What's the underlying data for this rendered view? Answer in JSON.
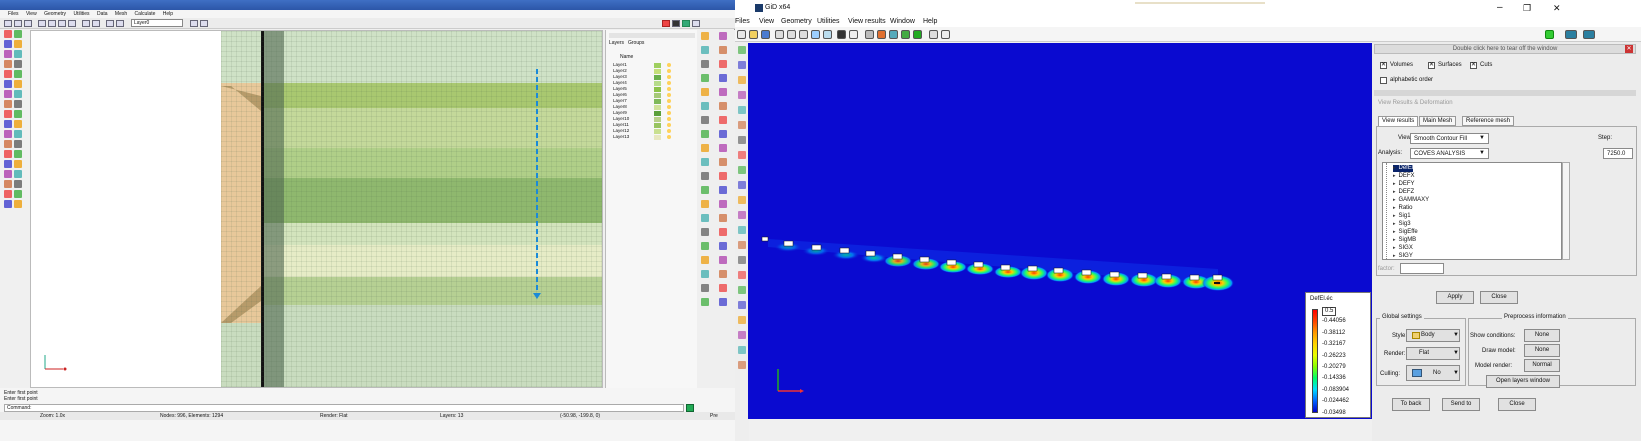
{
  "left_window": {
    "menu": [
      "Files",
      "View",
      "Geometry",
      "Utilities",
      "Data",
      "Mesh",
      "Calculate",
      "Help"
    ],
    "layer_select": "Layer0",
    "layers_tabs": [
      "Layers",
      "Groups"
    ],
    "layers_header": "Name",
    "layers": [
      "Layer1",
      "Layer2",
      "Layer3",
      "Layer4",
      "Layer5",
      "Layer6",
      "Layer7",
      "Layer8",
      "Layer9",
      "Layer10",
      "Layer11",
      "Layer12",
      "Layer13"
    ],
    "prompt_lines": [
      "Enter first point",
      "Enter first point"
    ],
    "command_label": "Command:",
    "status": {
      "zoom": "Zoom: 1.0x",
      "nodes": "Nodes: 996, Elements: 1294",
      "render": "Render: Flat",
      "layers": "Layers: 13",
      "coords": "(-50.98, -199.8, 0)",
      "mode": "Pre"
    }
  },
  "right_window": {
    "title": "GiD x64",
    "menu": [
      "Files",
      "View",
      "Geometry",
      "Utilities",
      "View results",
      "Window",
      "Help"
    ],
    "legend": {
      "title": "DefEl.éc",
      "values": [
        "0.5",
        "0.44056",
        "0.38112",
        "0.32167",
        "0.26223",
        "0.20279",
        "0.14336",
        "0.083904",
        "0.024462",
        "-0.03498"
      ],
      "colors": [
        "#ff0000",
        "#ff4400",
        "#ff9900",
        "#ffd400",
        "#e8ff00",
        "#88ff00",
        "#00ff66",
        "#00ddff",
        "#0066ff",
        "#0000cc"
      ]
    }
  },
  "panel": {
    "hint": "Double click here to tear off the window",
    "cut_opts": [
      "Volumes",
      "Surfaces",
      "Cuts"
    ],
    "alphabetic": "alphabetic order",
    "section_title": "View Results & Deformation",
    "tabs": [
      "View results",
      "Main Mesh",
      "Reference mesh"
    ],
    "view_label": "View:",
    "view_value": "Smooth Contour Fill",
    "step_label": "Step:",
    "analysis_label": "Analysis:",
    "analysis_value": "COVES ANALYSIS",
    "step_value": "7250.0",
    "results": [
      "DefEl",
      "DEFX",
      "DEFY",
      "DEFZ",
      "GAMMAXY",
      "Ratio",
      "Sig1",
      "Sig3",
      "SigEffe",
      "SigMB",
      "SIGX",
      "SIGY"
    ],
    "factor_label": "factor:",
    "apply": "Apply",
    "close": "Close",
    "global_settings": "Global settings",
    "preprocess_info": "Preprocess information",
    "style_label": "Style:",
    "style_value": "Body",
    "render_label": "Render:",
    "render_value": "Flat",
    "culling_label": "Culling:",
    "culling_value": "No",
    "show_conditions": "Show conditions:",
    "show_conditions_value": "None",
    "draw_model": "Draw model:",
    "draw_model_value": "None",
    "model_render": "Model render:",
    "model_render_value": "Normal",
    "open_layers": "Open layers window",
    "to_back": "To back",
    "send_to": "Send to",
    "bottom_close": "Close"
  }
}
